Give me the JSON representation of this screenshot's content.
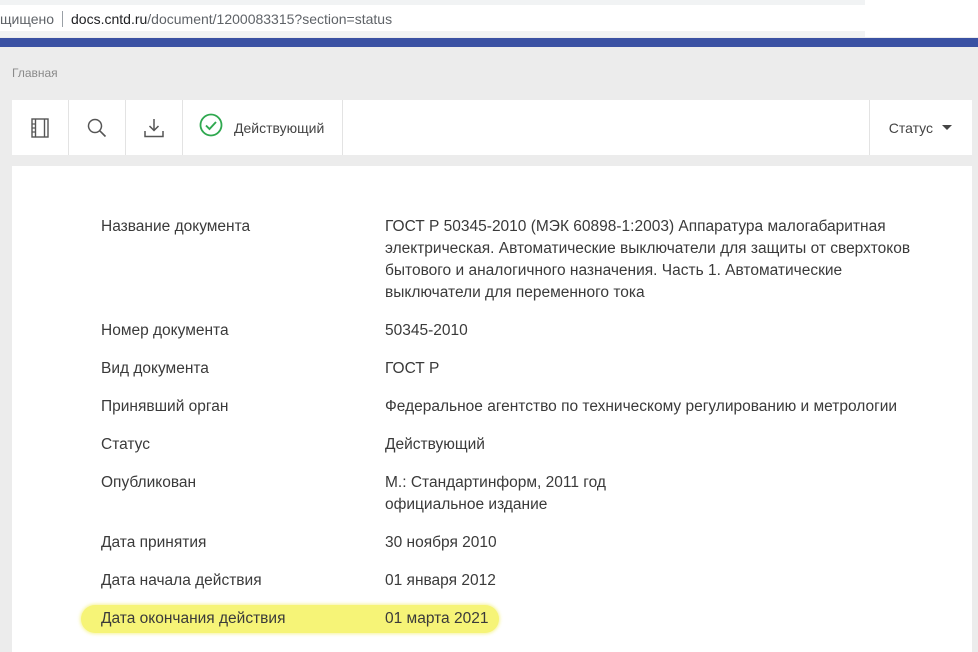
{
  "browser": {
    "security_text": "щищено",
    "url_host": "docs.cntd.ru",
    "url_path": "/document/1200083315?section=status"
  },
  "colors": {
    "brand_bar": "#3a51a3",
    "status_ok": "#2fa84f",
    "highlight": "#f6f477"
  },
  "breadcrumb": {
    "home": "Главная"
  },
  "toolbar": {
    "icons": [
      "document-icon",
      "search-icon",
      "download-icon",
      "check-circle-icon"
    ],
    "status_label": "Действующий",
    "status_dropdown_label": "Статус"
  },
  "document": {
    "rows": [
      {
        "key": "Название документа",
        "value": "ГОСТ Р 50345-2010 (МЭК 60898-1:2003) Аппаратура малогабаритная электрическая. Автоматические выключатели для защиты от сверхтоков бытового и аналогичного назначения. Часть 1. Автоматические выключатели для переменного тока"
      },
      {
        "key": "Номер документа",
        "value": "50345-2010"
      },
      {
        "key": "Вид документа",
        "value": "ГОСТ Р"
      },
      {
        "key": "Принявший орган",
        "value": "Федеральное агентство по техническому регулированию и метрологии"
      },
      {
        "key": "Статус",
        "value": "Действующий"
      },
      {
        "key": "Опубликован",
        "value": "М.: Стандартинформ, 2011 год",
        "value2": "официальное издание"
      },
      {
        "key": "Дата принятия",
        "value": "30 ноября 2010"
      },
      {
        "key": "Дата начала действия",
        "value": "01 января 2012"
      },
      {
        "key": "Дата окончания действия",
        "value": "01 марта 2021"
      }
    ]
  }
}
